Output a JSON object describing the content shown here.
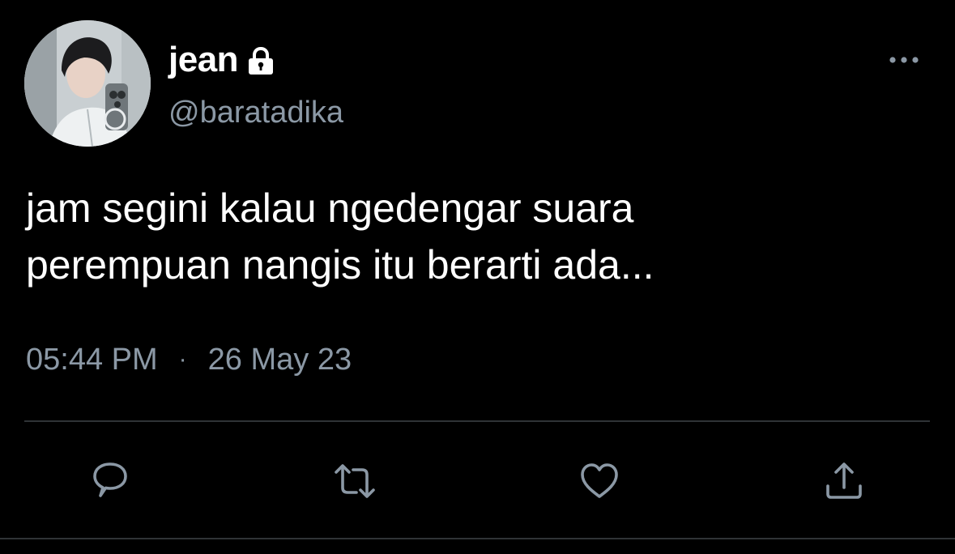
{
  "user": {
    "display_name": "jean",
    "handle": "@baratadika",
    "protected_icon": "lock-icon"
  },
  "tweet": {
    "text_lines": [
      "jam segini kalau ngedengar suara",
      "perempuan nangis itu berarti ada..."
    ],
    "time": "05:44 PM",
    "separator": "·",
    "date": "26 May 23"
  },
  "actions": [
    {
      "icon": "reply-icon"
    },
    {
      "icon": "retweet-icon"
    },
    {
      "icon": "like-icon"
    },
    {
      "icon": "share-icon"
    }
  ],
  "colors": {
    "background": "#000000",
    "text": "#ffffff",
    "secondary": "#8b98a5",
    "divider": "#2f3336"
  }
}
